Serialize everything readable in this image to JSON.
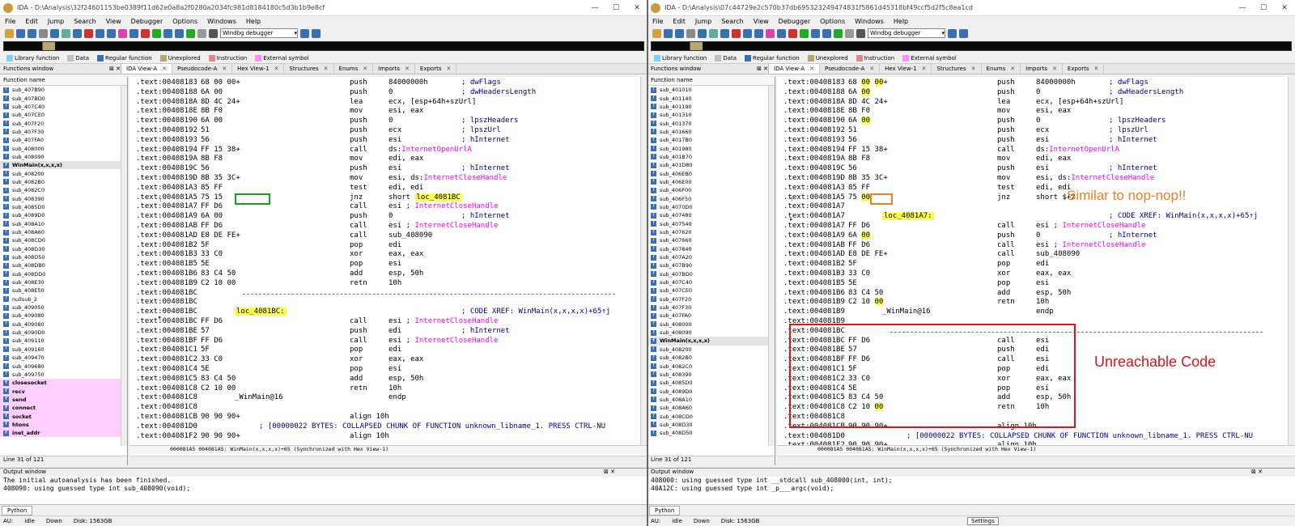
{
  "left": {
    "title": "IDA - D:\\Analysis\\32f24601153be0389f11d62e0a8a2f0280a2034fc981d8184180c5d3b1b9e8cf",
    "selected_function": "WinMain(x,x,x,x)",
    "functions": [
      "sub_407B90",
      "sub_407BD0",
      "sub_407C40",
      "sub_407CE0",
      "sub_407F20",
      "sub_407F30",
      "sub_407FA0",
      "sub_408000",
      "sub_408090",
      "WinMain(x,x,x,x)",
      "sub_408200",
      "sub_4082B0",
      "sub_4082C0",
      "sub_408390",
      "sub_4085D0",
      "sub_4089D0",
      "sub_408A10",
      "sub_408A60",
      "sub_408CD0",
      "sub_408D30",
      "sub_408D50",
      "sub_408DB0",
      "sub_408DD0",
      "sub_408E30",
      "sub_408E50",
      "nullsub_2",
      "sub_409050",
      "sub_409080",
      "sub_409080",
      "sub_4090D0",
      "sub_409110",
      "sub_409160",
      "sub_409470",
      "sub_409680",
      "sub_409750"
    ],
    "imports": [
      "closesocket",
      "recv",
      "send",
      "connect",
      "socket",
      "htons",
      "inet_addr"
    ],
    "line_status": "Line 31 of 121",
    "code_status": "000081A5 004081A5: WinMain(x,x,x,x)+65 (Synchronized with Hex View-1)",
    "output": [
      "The initial autoanalysis has been finished.",
      "408090: using guessed type int sub_408090(void);"
    ],
    "lines": [
      {
        "a": ".text:00408183",
        "b": "68 00 00+",
        "m": "push",
        "o": "84000000h",
        "c": "; dwFlags"
      },
      {
        "a": ".text:00408188",
        "b": "6A 00",
        "m": "push",
        "o": "0",
        "c": "; dwHeadersLength"
      },
      {
        "a": ".text:0040818A",
        "b": "8D 4C 24+",
        "m": "lea",
        "o": "ecx, [esp+64h+szUrl]",
        "c": ""
      },
      {
        "a": ".text:0040818E",
        "b": "8B F0",
        "m": "mov",
        "o": "esi, eax",
        "c": ""
      },
      {
        "a": ".text:00408190",
        "b": "6A 00",
        "m": "push",
        "o": "0",
        "c": "; lpszHeaders"
      },
      {
        "a": ".text:00408192",
        "b": "51",
        "m": "push",
        "o": "ecx",
        "c": "; lpszUrl"
      },
      {
        "a": ".text:00408193",
        "b": "56",
        "m": "push",
        "o": "esi",
        "c": "; hInternet"
      },
      {
        "a": ".text:00408194",
        "b": "FF 15 38+",
        "m": "call",
        "o": "ds:InternetOpenUrlA",
        "c": ""
      },
      {
        "a": ".text:0040819A",
        "b": "8B F8",
        "m": "mov",
        "o": "edi, eax",
        "c": ""
      },
      {
        "a": ".text:0040819C",
        "b": "56",
        "m": "push",
        "o": "esi",
        "c": "; hInternet"
      },
      {
        "a": ".text:0040819D",
        "b": "8B 35 3C+",
        "m": "mov",
        "o": "esi, ds:InternetCloseHandle",
        "c": ""
      },
      {
        "a": ".text:004081A3",
        "b": "85 FF",
        "m": "test",
        "o": "edi, edi",
        "c": ""
      },
      {
        "a": ".text:004081A5",
        "b": "75 15",
        "m": "jnz",
        "o": "short loc_4081BC",
        "c": ""
      },
      {
        "a": ".text:004081A7",
        "b": "FF D6",
        "m": "call",
        "o": "esi ; InternetCloseHandle",
        "c": ""
      },
      {
        "a": ".text:004081A9",
        "b": "6A 00",
        "m": "push",
        "o": "0",
        "c": "; hInternet"
      },
      {
        "a": ".text:004081AB",
        "b": "FF D6",
        "m": "call",
        "o": "esi ; InternetCloseHandle",
        "c": ""
      },
      {
        "a": ".text:004081AD",
        "b": "E8 DE FE+",
        "m": "call",
        "o": "sub_408090",
        "c": ""
      },
      {
        "a": ".text:004081B2",
        "b": "5F",
        "m": "pop",
        "o": "edi",
        "c": ""
      },
      {
        "a": ".text:004081B3",
        "b": "33 C0",
        "m": "xor",
        "o": "eax, eax",
        "c": ""
      },
      {
        "a": ".text:004081B5",
        "b": "5E",
        "m": "pop",
        "o": "esi",
        "c": ""
      },
      {
        "a": ".text:004081B6",
        "b": "83 C4 50",
        "m": "add",
        "o": "esp, 50h",
        "c": ""
      },
      {
        "a": ".text:004081B9",
        "b": "C2 10 00",
        "m": "retn",
        "o": "10h",
        "c": ""
      },
      {
        "a": ".text:004081BC",
        "b": "",
        "m": "",
        "o": "",
        "c": ""
      },
      {
        "a": ".text:004081BC",
        "b": "",
        "m": "",
        "o": "",
        "c": ""
      },
      {
        "a": ".text:004081BC",
        "b": "",
        "m": "loc_4081BC:",
        "o": "",
        "c": "; CODE XREF: WinMain(x,x,x,x)+65↑j"
      },
      {
        "a": ".text:004081BC",
        "b": "FF D6",
        "m": "call",
        "o": "esi ; InternetCloseHandle",
        "c": ""
      },
      {
        "a": ".text:004081BE",
        "b": "57",
        "m": "push",
        "o": "edi",
        "c": "; hInternet"
      },
      {
        "a": ".text:004081BF",
        "b": "FF D6",
        "m": "call",
        "o": "esi ; InternetCloseHandle",
        "c": ""
      },
      {
        "a": ".text:004081C1",
        "b": "5F",
        "m": "pop",
        "o": "edi",
        "c": ""
      },
      {
        "a": ".text:004081C2",
        "b": "33 C0",
        "m": "xor",
        "o": "eax, eax",
        "c": ""
      },
      {
        "a": ".text:004081C4",
        "b": "5E",
        "m": "pop",
        "o": "esi",
        "c": ""
      },
      {
        "a": ".text:004081C5",
        "b": "83 C4 50",
        "m": "add",
        "o": "esp, 50h",
        "c": ""
      },
      {
        "a": ".text:004081C8",
        "b": "C2 10 00",
        "m": "retn",
        "o": "10h",
        "c": ""
      },
      {
        "a": ".text:004081C8",
        "b": "",
        "m": "_WinMain@16",
        "o": "endp",
        "c": ""
      },
      {
        "a": ".text:004081C8",
        "b": "",
        "m": "",
        "o": "",
        "c": ""
      },
      {
        "a": ".text:004081CB",
        "b": "90 90 90+",
        "m": "align 10h",
        "o": "",
        "c": ""
      },
      {
        "a": ".text:004081D0",
        "b": "",
        "m": "; [00000022 BYTES: COLLAPSED CHUNK OF FUNCTION unknown_libname_1. PRESS CTRL-NU",
        "o": "",
        "c": ""
      },
      {
        "a": ".text:004081F2",
        "b": "90 90 90+",
        "m": "align 10h",
        "o": "",
        "c": ""
      }
    ]
  },
  "right": {
    "title": "IDA - D:\\Analysis\\07c44729e2c570b37db695323249474831f5861d45318bf49ccf5d2f5c8ea1cd",
    "selected_function": "WinMain(x,x,x,x)",
    "functions": [
      "sub_401010",
      "sub_401140",
      "sub_401190",
      "sub_401310",
      "sub_401370",
      "sub_401660",
      "sub_4017B0",
      "sub_401980",
      "sub_401B70",
      "sub_401D80",
      "sub_406EB0",
      "sub_406E00",
      "sub_406F00",
      "sub_406F50",
      "sub_4070D0",
      "sub_407480",
      "sub_407540",
      "sub_407620",
      "sub_407660",
      "sub_407840",
      "sub_407A20",
      "sub_407B90",
      "sub_407BD0",
      "sub_407C40",
      "sub_407CE0",
      "sub_407F20",
      "sub_407F30",
      "sub_407FA0",
      "sub_408000",
      "sub_408090",
      "WinMain(x,x,x,x)",
      "sub_408200",
      "sub_4082B0",
      "sub_4082C0",
      "sub_408390",
      "sub_4085D0",
      "sub_4089D0",
      "sub_408A10",
      "sub_408A60",
      "sub_408CD0",
      "sub_408D30",
      "sub_408D50"
    ],
    "line_status": "Line 31 of 121",
    "code_status": "000081A5 004081A5: WinMain(x,x,x,x)+65 (Synchronized with Hex View-1)",
    "output": [
      "408000: using guessed type int __stdcall sub_408000(int, int);",
      "40A12C: using guessed type int _p___argc(void);"
    ],
    "settings_label": "Settings",
    "annotation_nop": "Similar to nop-nop!!",
    "annotation_unreachable": "Unreachable Code",
    "lines": [
      {
        "a": ".text:00408183",
        "b": "68 00 00+",
        "m": "push",
        "o": "84000000h",
        "c": "; dwFlags"
      },
      {
        "a": ".text:00408188",
        "b": "6A 00",
        "m": "push",
        "o": "0",
        "c": "; dwHeadersLength"
      },
      {
        "a": ".text:0040818A",
        "b": "8D 4C 24+",
        "m": "lea",
        "o": "ecx, [esp+64h+szUrl]",
        "c": ""
      },
      {
        "a": ".text:0040818E",
        "b": "8B F0",
        "m": "mov",
        "o": "esi, eax",
        "c": ""
      },
      {
        "a": ".text:00408190",
        "b": "6A 00",
        "m": "push",
        "o": "0",
        "c": "; lpszHeaders"
      },
      {
        "a": ".text:00408192",
        "b": "51",
        "m": "push",
        "o": "ecx",
        "c": "; lpszUrl"
      },
      {
        "a": ".text:00408193",
        "b": "56",
        "m": "push",
        "o": "esi",
        "c": "; hInternet"
      },
      {
        "a": ".text:00408194",
        "b": "FF 15 38+",
        "m": "call",
        "o": "ds:InternetOpenUrlA",
        "c": ""
      },
      {
        "a": ".text:0040819A",
        "b": "8B F8",
        "m": "mov",
        "o": "edi, eax",
        "c": ""
      },
      {
        "a": ".text:0040819C",
        "b": "56",
        "m": "push",
        "o": "esi",
        "c": "; hInternet"
      },
      {
        "a": ".text:0040819D",
        "b": "8B 35 3C+",
        "m": "mov",
        "o": "esi, ds:InternetCloseHandle",
        "c": ""
      },
      {
        "a": ".text:004081A3",
        "b": "85 FF",
        "m": "test",
        "o": "edi, edi",
        "c": ""
      },
      {
        "a": ".text:004081A5",
        "b": "75 00",
        "m": "jnz",
        "o": "short $+2",
        "c": ""
      },
      {
        "a": ".text:004081A7",
        "b": "",
        "m": "",
        "o": "",
        "c": ""
      },
      {
        "a": ".text:004081A7",
        "b": "",
        "m": "loc_4081A7:",
        "o": "",
        "c": "; CODE XREF: WinMain(x,x,x,x)+65↑j"
      },
      {
        "a": ".text:004081A7",
        "b": "FF D6",
        "m": "call",
        "o": "esi ; InternetCloseHandle",
        "c": ""
      },
      {
        "a": ".text:004081A9",
        "b": "6A 00",
        "m": "push",
        "o": "0",
        "c": "; hInternet"
      },
      {
        "a": ".text:004081AB",
        "b": "FF D6",
        "m": "call",
        "o": "esi ; InternetCloseHandle",
        "c": ""
      },
      {
        "a": ".text:004081AD",
        "b": "E8 DE FE+",
        "m": "call",
        "o": "sub_408090",
        "c": ""
      },
      {
        "a": ".text:004081B2",
        "b": "5F",
        "m": "pop",
        "o": "edi",
        "c": ""
      },
      {
        "a": ".text:004081B3",
        "b": "33 C0",
        "m": "xor",
        "o": "eax, eax",
        "c": ""
      },
      {
        "a": ".text:004081B5",
        "b": "5E",
        "m": "pop",
        "o": "esi",
        "c": ""
      },
      {
        "a": ".text:004081B6",
        "b": "83 C4 50",
        "m": "add",
        "o": "esp, 50h",
        "c": ""
      },
      {
        "a": ".text:004081B9",
        "b": "C2 10 00",
        "m": "retn",
        "o": "10h",
        "c": ""
      },
      {
        "a": ".text:004081B9",
        "b": "",
        "m": "_WinMain@16",
        "o": "endp",
        "c": ""
      },
      {
        "a": ".text:004081B9",
        "b": "",
        "m": "",
        "o": "",
        "c": ""
      },
      {
        "a": ".text:004081BC",
        "b": "",
        "m": "",
        "o": "",
        "c": ""
      },
      {
        "a": ".text:004081BC",
        "b": "FF D6",
        "m": "call",
        "o": "esi",
        "c": ""
      },
      {
        "a": ".text:004081BE",
        "b": "57",
        "m": "push",
        "o": "edi",
        "c": ""
      },
      {
        "a": ".text:004081BF",
        "b": "FF D6",
        "m": "call",
        "o": "esi",
        "c": ""
      },
      {
        "a": ".text:004081C1",
        "b": "5F",
        "m": "pop",
        "o": "edi",
        "c": ""
      },
      {
        "a": ".text:004081C2",
        "b": "33 C0",
        "m": "xor",
        "o": "eax, eax",
        "c": ""
      },
      {
        "a": ".text:004081C4",
        "b": "5E",
        "m": "pop",
        "o": "esi",
        "c": ""
      },
      {
        "a": ".text:004081C5",
        "b": "83 C4 50",
        "m": "add",
        "o": "esp, 50h",
        "c": ""
      },
      {
        "a": ".text:004081C8",
        "b": "C2 10 00",
        "m": "retn",
        "o": "10h",
        "c": ""
      },
      {
        "a": ".text:004081C8",
        "b": "",
        "m": "",
        "o": "",
        "c": ""
      },
      {
        "a": ".text:004081CB",
        "b": "90 90 90+",
        "m": "align 10h",
        "o": "",
        "c": ""
      },
      {
        "a": ".text:004081D0",
        "b": "",
        "m": "; [00000022 BYTES: COLLAPSED CHUNK OF FUNCTION unknown_libname_1. PRESS CTRL-NU",
        "o": "",
        "c": ""
      },
      {
        "a": ".text:004081F2",
        "b": "90 90 90+",
        "m": "align 10h",
        "o": "",
        "c": ""
      }
    ]
  },
  "common": {
    "menu": [
      "File",
      "Edit",
      "Jump",
      "Search",
      "View",
      "Debugger",
      "Options",
      "Windows",
      "Help"
    ],
    "debugger_select": "Windbg debugger",
    "legend": [
      {
        "label": "Library function",
        "color": "#7fd0ff"
      },
      {
        "label": "Data",
        "color": "#c0c0c0"
      },
      {
        "label": "Regular function",
        "color": "#3a6fb0"
      },
      {
        "label": "Unexplored",
        "color": "#b6a874"
      },
      {
        "label": "Instruction",
        "color": "#e08a8a"
      },
      {
        "label": "External symbol",
        "color": "#ff90ff"
      }
    ],
    "functions_window_label": "Functions window",
    "function_name_header": "Function name",
    "tabs": [
      "IDA View-A",
      "Pseudocode-A",
      "Hex View-1",
      "Structures",
      "Enums",
      "Imports",
      "Exports"
    ],
    "output_window_label": "Output window",
    "python_label": "Python",
    "status": {
      "au": "AU:",
      "idle": "idle",
      "down": "Down",
      "disk": "Disk: 1563GB"
    }
  }
}
